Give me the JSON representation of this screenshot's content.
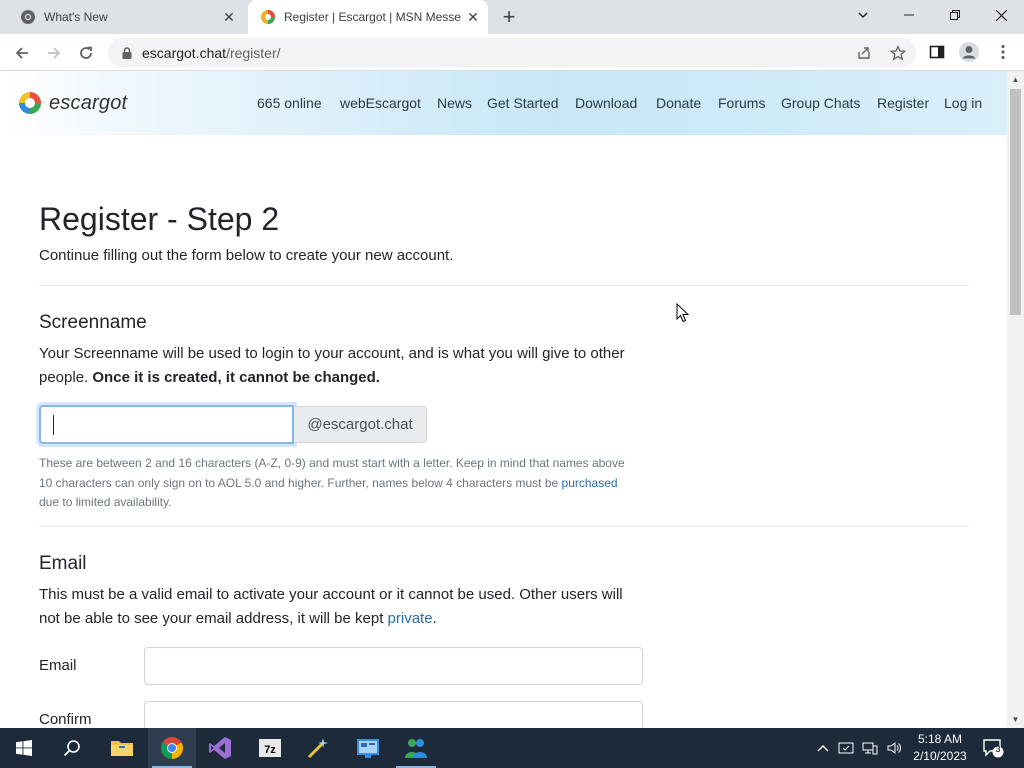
{
  "browser": {
    "tabs": [
      {
        "title": "What's New",
        "active": false
      },
      {
        "title": "Register | Escargot | MSN Messe",
        "active": true
      }
    ],
    "url_host": "escargot.chat",
    "url_path": "/register/"
  },
  "site": {
    "logo_text": "escargot",
    "nav": [
      "665 online",
      "webEscargot",
      "News",
      "Get Started",
      "Download",
      "Donate",
      "Forums",
      "Group Chats",
      "Register",
      "Log in"
    ]
  },
  "page": {
    "title": "Register - Step 2",
    "lead": "Continue filling out the form below to create your new account.",
    "screenname": {
      "heading": "Screenname",
      "desc": "Your Screenname will be used to login to your account, and is what you will give to other people.",
      "desc_bold": "Once it is created, it cannot be changed.",
      "input_value": "",
      "addon": "@escargot.chat",
      "help_1": "These are between 2 and 16 characters (A-Z, 0-9) and must start with a letter. Keep in mind that names above 10 characters can only sign on to AOL 5.0 and higher. Further, names below 4 characters must be",
      "help_link": "purchased",
      "help_2": "due to limited availability."
    },
    "email": {
      "heading": "Email",
      "desc": "This must be a valid email to activate your account or it cannot be used. Other users will not be able to see your email address, it will be kept",
      "desc_link": "private",
      "desc_end": ".",
      "label_email": "Email",
      "label_confirm": "Confirm",
      "email_value": "",
      "confirm_value": ""
    }
  },
  "taskbar": {
    "time": "5:18 AM",
    "date": "2/10/2023",
    "notification_count": "3"
  },
  "colors": {
    "link": "#2a6fa8",
    "taskbar": "#1c2a3a",
    "header_gradient_end": "#c7e7f7"
  }
}
